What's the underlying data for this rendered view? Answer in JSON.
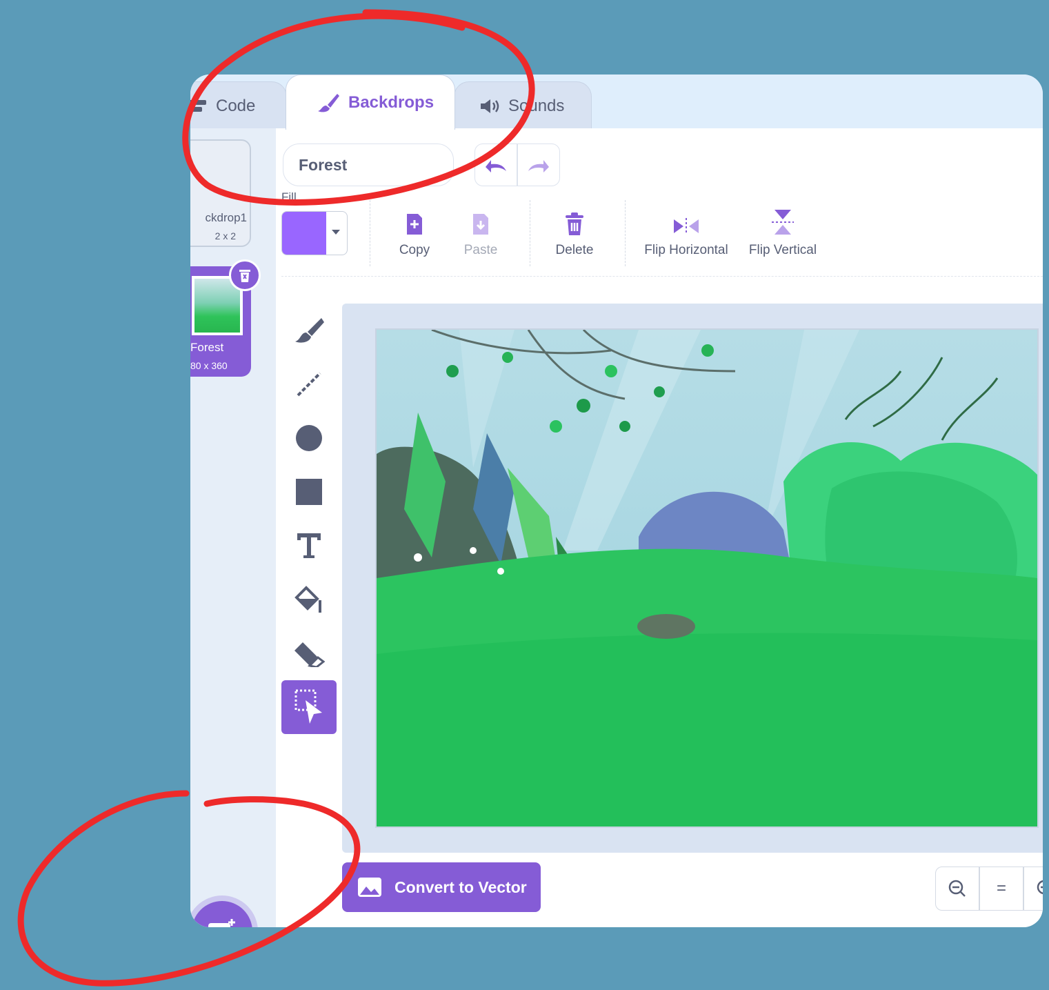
{
  "tabs": {
    "code": "Code",
    "backdrops": "Backdrops",
    "sounds": "Sounds"
  },
  "backdrop_list": [
    {
      "name": "ckdrop1",
      "size": "2 x 2"
    },
    {
      "name": "Forest",
      "size": "80 x 360"
    }
  ],
  "editor": {
    "backdrop_name": "Forest",
    "fill_label": "Fill",
    "fill_color": "#9966ff"
  },
  "toolbar": {
    "copy": "Copy",
    "paste": "Paste",
    "delete": "Delete",
    "flip_horizontal": "Flip Horizontal",
    "flip_vertical": "Flip Vertical"
  },
  "palette_tools": [
    "brush-icon",
    "line-icon",
    "circle-icon",
    "rectangle-icon",
    "text-icon",
    "fill-icon",
    "eraser-icon",
    "select-icon"
  ],
  "convert_button": "Convert to Vector",
  "zoom": {
    "reset": "="
  },
  "colors": {
    "accent": "#855cd6",
    "background": "#5b9bb8",
    "highlight_ring": "#ee2a2a"
  }
}
